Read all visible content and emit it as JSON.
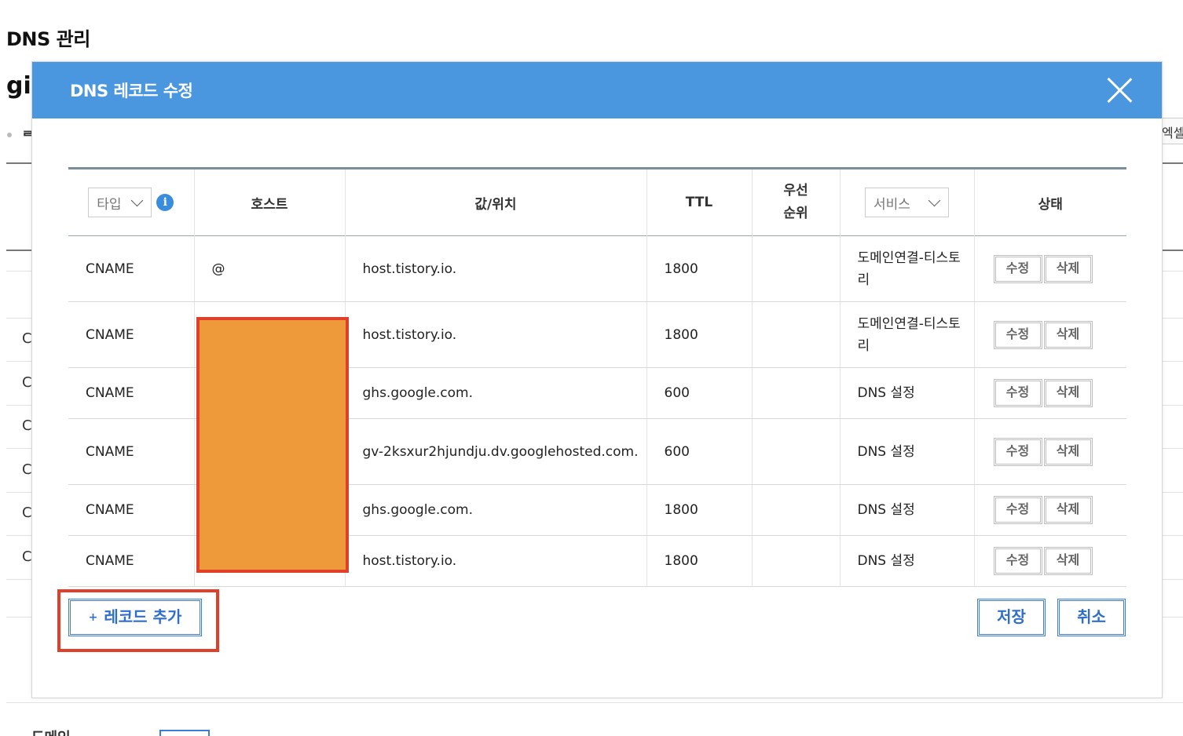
{
  "page": {
    "title": "DNS 관리",
    "domain_partial": "gi",
    "tab_partial": "ᄅ",
    "excel_partial": "엑셀",
    "bg_rows": [
      "C",
      "C",
      "C",
      "C",
      "C",
      "C"
    ],
    "bottom_label_partial": "도메인"
  },
  "modal": {
    "title": "DNS 레코드 수정",
    "close_icon": "close-x-icon",
    "header_color": "#4a97e0",
    "columns": {
      "type_select": "타입",
      "host": "호스트",
      "value": "값/위치",
      "ttl": "TTL",
      "priority": "우선\n순위",
      "service_select": "서비스",
      "status": "상태"
    },
    "records": [
      {
        "type": "CNAME",
        "host": "@",
        "value": "host.tistory.io.",
        "ttl": "1800",
        "priority": "",
        "service": "도메인연결-티스토리",
        "edit": "수정",
        "delete": "삭제"
      },
      {
        "type": "CNAME",
        "host": "",
        "value": "host.tistory.io.",
        "ttl": "1800",
        "priority": "",
        "service": "도메인연결-티스토리",
        "edit": "수정",
        "delete": "삭제"
      },
      {
        "type": "CNAME",
        "host": "",
        "value": "ghs.google.com.",
        "ttl": "600",
        "priority": "",
        "service": "DNS 설정",
        "edit": "수정",
        "delete": "삭제"
      },
      {
        "type": "CNAME",
        "host": "",
        "value": "gv-2ksxur2hjundju.dv.googlehosted.com.",
        "ttl": "600",
        "priority": "",
        "service": "DNS 설정",
        "edit": "수정",
        "delete": "삭제"
      },
      {
        "type": "CNAME",
        "host": "",
        "value": "ghs.google.com.",
        "ttl": "1800",
        "priority": "",
        "service": "DNS 설정",
        "edit": "수정",
        "delete": "삭제"
      },
      {
        "type": "CNAME",
        "host": "",
        "value": "host.tistory.io.",
        "ttl": "1800",
        "priority": "",
        "service": "DNS 설정",
        "edit": "수정",
        "delete": "삭제"
      }
    ],
    "add_record": "레코드 추가",
    "add_plus": "+",
    "save": "저장",
    "cancel": "취소",
    "redaction_color": "#ef9a3a",
    "highlight_color": "#e0402a"
  }
}
